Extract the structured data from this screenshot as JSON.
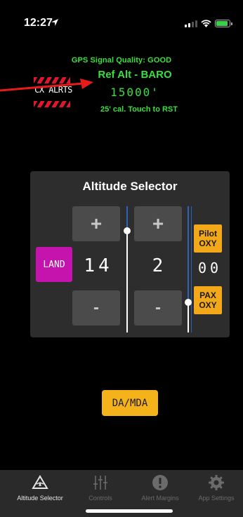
{
  "status_bar": {
    "time": "12:27",
    "icons": [
      "location-arrow-icon",
      "cellular-signal-icon",
      "wifi-icon",
      "battery-charging-icon"
    ],
    "battery_color": "#37d24a"
  },
  "header": {
    "gps_quality": "GPS Signal Quality: GOOD",
    "ref_alt": "Ref Alt - BARO",
    "ref_value": "15000'",
    "calibration": "25' cal. Touch to RST",
    "logo_text": "CX ALRTS",
    "accent_color": "#38e03c",
    "logo_stripe_color": "#e0162b",
    "arrow_color": "#e81b1b"
  },
  "selector": {
    "title": "Altitude Selector",
    "plus_label": "+",
    "minus_label": "-",
    "land_label": "LAND",
    "thousands": "14",
    "hundreds": "2",
    "tens": "00",
    "pilot_oxy": [
      "Pilot",
      "OXY"
    ],
    "pax_oxy": [
      "PAX",
      "OXY"
    ],
    "land_color": "#c414ad",
    "oxy_color": "#f2a818",
    "slider_color": "#2d63b8"
  },
  "da_mda_label": "DA/MDA",
  "tabs": [
    {
      "label": "Altitude Selector",
      "icon": "altitude-selector-icon",
      "active": true
    },
    {
      "label": "Controls",
      "icon": "sliders-icon",
      "active": false
    },
    {
      "label": "Alert Margins",
      "icon": "exclamation-circle-icon",
      "active": false
    },
    {
      "label": "App Settings",
      "icon": "gear-icon",
      "active": false
    }
  ]
}
